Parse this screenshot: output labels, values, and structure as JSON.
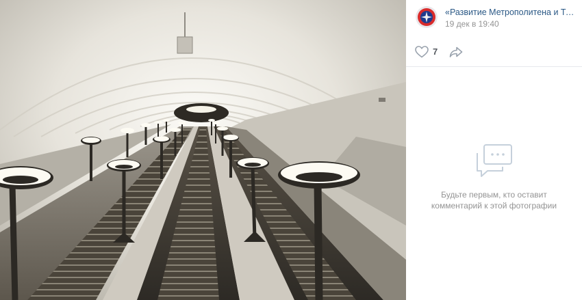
{
  "photo": {
    "alt": "Escalator tunnel photo",
    "scene_colors": {
      "vault": "#efeeea",
      "shadow": "#a7a49c",
      "lamp_light": "#fdfbf3",
      "escalator": "#3a342a"
    }
  },
  "post": {
    "author_name": "«Развитие Метрополитена и Трансп",
    "date": "19 дек в 19:40",
    "likes": "7"
  },
  "comments": {
    "empty_line1": "Будьте первым, кто оставит",
    "empty_line2": "комментарий к этой фотографии"
  },
  "colors": {
    "link": "#2a5885",
    "muted": "#939393",
    "icon": "#99a2ad"
  }
}
